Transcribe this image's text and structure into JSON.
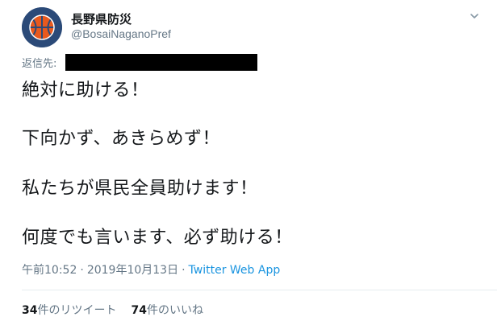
{
  "account": {
    "display_name": "長野県防災",
    "handle": "@BosaiNaganoPref",
    "avatar_icon": "basketball-logo-icon"
  },
  "menu_icon": "chevron-down-icon",
  "reply_to_label": "返信先:",
  "tweet_lines": [
    "絶対に助ける！",
    "下向かず、あきらめず！",
    "私たちが県民全員助けます！",
    "何度でも言います、必ず助ける！"
  ],
  "meta": {
    "time": "午前10:52",
    "separator": "·",
    "date": "2019年10月13日",
    "source": "Twitter Web App"
  },
  "stats": {
    "retweets_count": "34",
    "retweets_label": "件のリツイート",
    "likes_count": "74",
    "likes_label": "件のいいね"
  },
  "colors": {
    "text": "#14171a",
    "secondary": "#657786",
    "link": "#1b95e0",
    "avatar_bg": "#2b4a78",
    "avatar_ball": "#e8591e"
  }
}
